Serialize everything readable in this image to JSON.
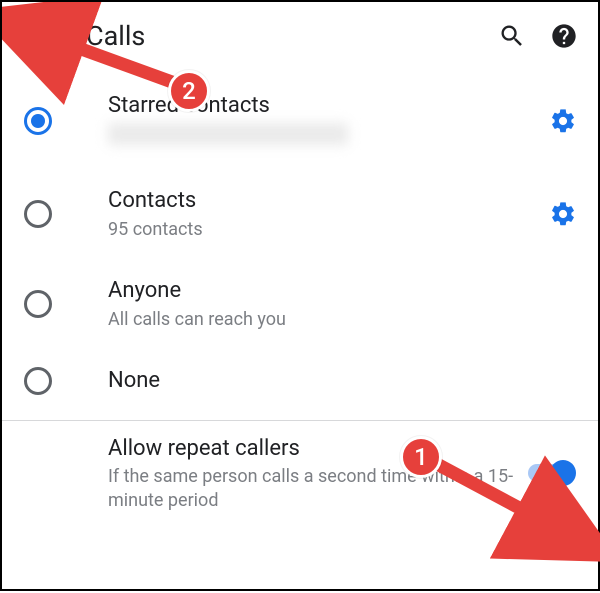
{
  "header": {
    "title": "Calls"
  },
  "options": [
    {
      "label": "Starred contacts",
      "sub": "",
      "selected": true,
      "gear": true,
      "blurSub": true
    },
    {
      "label": "Contacts",
      "sub": "95 contacts",
      "selected": false,
      "gear": true,
      "blurSub": false
    },
    {
      "label": "Anyone",
      "sub": "All calls can reach you",
      "selected": false,
      "gear": false,
      "blurSub": false
    },
    {
      "label": "None",
      "sub": "",
      "selected": false,
      "gear": false,
      "blurSub": false
    }
  ],
  "repeat": {
    "label": "Allow repeat callers",
    "sub": "If the same person calls a second time within a 15-minute period",
    "on": true
  },
  "annotations": {
    "b1": "1",
    "b2": "2"
  }
}
